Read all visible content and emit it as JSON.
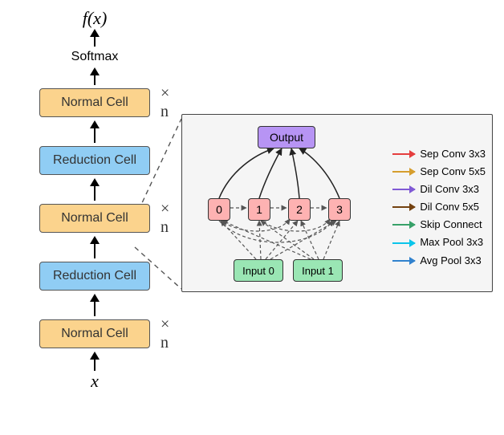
{
  "output_label": "f(x)",
  "input_label": "x",
  "softmax_label": "Softmax",
  "times_n": "× n",
  "cells": {
    "normal_label": "Normal Cell",
    "reduction_label": "Reduction Cell"
  },
  "dag": {
    "output": "Output",
    "hidden": [
      "0",
      "1",
      "2",
      "3"
    ],
    "inputs": [
      "Input 0",
      "Input 1"
    ]
  },
  "legend": [
    {
      "label": "Sep Conv 3x3",
      "color": "#e53e3e"
    },
    {
      "label": "Sep Conv 5x5",
      "color": "#d69e2e"
    },
    {
      "label": "Dil Conv 3x3",
      "color": "#805ad5"
    },
    {
      "label": "Dil Conv 5x5",
      "color": "#744210"
    },
    {
      "label": "Skip Connect",
      "color": "#38a169"
    },
    {
      "label": "Max Pool 3x3",
      "color": "#0bc5ea"
    },
    {
      "label": "Avg Pool 3x3",
      "color": "#3182ce"
    }
  ],
  "stack_layers": [
    {
      "type": "normal",
      "show_n": true
    },
    {
      "type": "reduction",
      "show_n": false
    },
    {
      "type": "normal",
      "show_n": true
    },
    {
      "type": "reduction",
      "show_n": false
    },
    {
      "type": "normal",
      "show_n": true
    }
  ]
}
